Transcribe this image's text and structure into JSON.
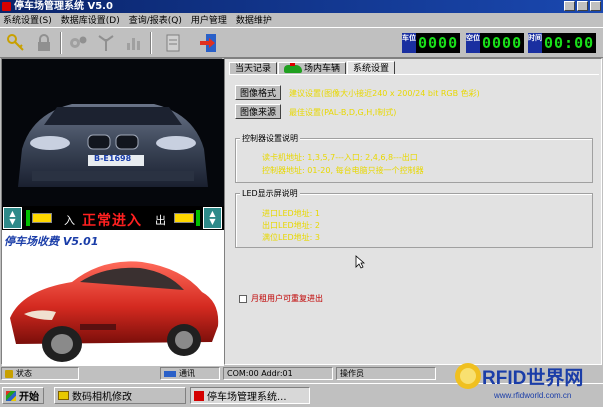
{
  "window": {
    "title": "停车场管理系统 V5.0"
  },
  "menu": [
    "系统设置(S)",
    "数据库设置(D)",
    "查询/报表(Q)",
    "用户管理",
    "数据维护"
  ],
  "toolbar": {
    "icons": [
      "keys-icon",
      "lock-icon",
      "gears-icon",
      "antenna-icon",
      "chart-icon",
      "form-icon",
      "exit-door-icon"
    ]
  },
  "counters": [
    {
      "label": "车位",
      "value": "0000"
    },
    {
      "label": "空位",
      "value": "0000"
    },
    {
      "label": "时间",
      "value": "00:00"
    }
  ],
  "camera": {
    "plate_text": "B-E1698"
  },
  "entry": {
    "in_label": "入",
    "status": "正常进入",
    "out_label": "出"
  },
  "fee_panel": {
    "title": "停车场收费 V5.01"
  },
  "tabs": [
    {
      "label": "当天记录",
      "active": false
    },
    {
      "label": "场内车辆",
      "active": false
    },
    {
      "label": "系统设置",
      "active": true
    }
  ],
  "settings": {
    "image_format_button": "图像格式",
    "image_format_text": "建议设置(图像大小接近240 x 200/24 bit RGB 色彩)",
    "image_source_button": "图像来源",
    "image_source_text": "最佳设置(PAL-B,D,G,H,I制式)",
    "controller_group": {
      "title": "控制器设置说明",
      "lines": [
        "读卡机地址: 1,3,5,7---入口;   2,4,6,8---出口",
        "控制器地址: 01-20, 每台电脑只接一个控制器"
      ]
    },
    "led_group": {
      "title": "LED显示屏说明",
      "lines": [
        "进口LED地址: 1",
        "出口LED地址: 2",
        "满位LED地址: 3"
      ]
    },
    "monthly_checkbox": {
      "label": "月租用户可重复进出",
      "checked": false
    }
  },
  "statusbar": {
    "status": "状态",
    "comm": "通讯",
    "com_info": "COM:00 Addr:01",
    "operator": "操作员"
  },
  "taskbar": {
    "start": "开始",
    "tasks": [
      "数码相机修改",
      "停车场管理系统..."
    ]
  },
  "watermark": {
    "brand": "RFID世界网",
    "url": "www.rfidworld.com.cn"
  },
  "colors": {
    "title_bar": "#0a246a",
    "led_green": "#19e019",
    "status_red": "#ff2020",
    "note_yellow": "#e8d800"
  }
}
